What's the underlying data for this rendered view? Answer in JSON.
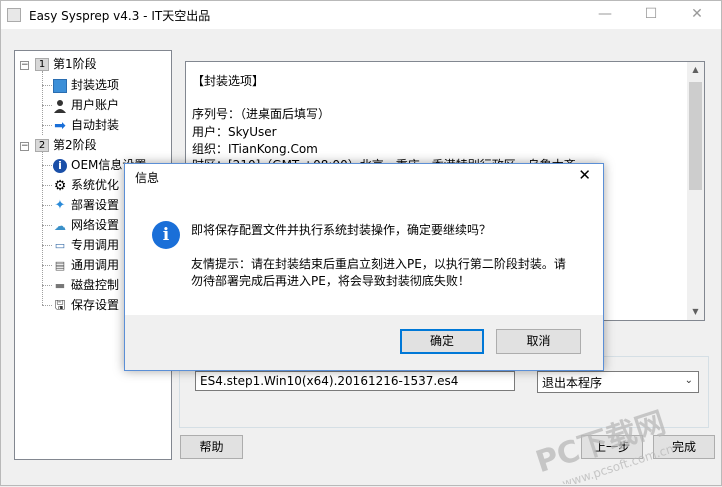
{
  "window": {
    "title": "Easy Sysprep v4.3 - IT天空出品",
    "minimize": "—",
    "maximize": "☐",
    "close": "✕"
  },
  "tree": {
    "stage1": {
      "num": "1",
      "label": "第1阶段"
    },
    "stage1_items": [
      "封装选项",
      "用户账户",
      "自动封装"
    ],
    "stage2": {
      "num": "2",
      "label": "第2阶段"
    },
    "stage2_items": [
      "OEM信息设置",
      "系统优化",
      "部署设置",
      "网络设置",
      "专用调用",
      "通用调用",
      "磁盘控制",
      "保存设置"
    ]
  },
  "content": {
    "lines": [
      "【封装选项】",
      "序列号：（进桌面后填写）",
      "用户：SkyUser",
      "组织：ITianKong.Com",
      "时区：[210]（GMT +08:00）北京，重庆，香港特别行政区，乌鲁木齐"
    ]
  },
  "file": {
    "value": "ES4.step1.Win10(x64).20161216-1537.es4"
  },
  "after_action": {
    "value": "退出本程序"
  },
  "buttons": {
    "help": "帮助",
    "back": "上一步",
    "finish": "完成"
  },
  "dialog": {
    "title": "信息",
    "close": "✕",
    "icon": "i",
    "question": "即将保存配置文件并执行系统封装操作，确定要继续吗？",
    "tip_line1": "友情提示：请在封装结束后重启立刻进入PE，以执行第二阶段封装。请",
    "tip_line2": "勿待部署完成后再进入PE，将会导致封装彻底失败！",
    "ok": "确定",
    "cancel": "取消"
  },
  "watermark": {
    "text": "PC下载网",
    "url": "www.pcsoft.com.cn"
  },
  "colors": {
    "dialog_border": "#5b8fd6",
    "info_icon": "#1a6fd8",
    "default_button_border": "#0078d7"
  }
}
